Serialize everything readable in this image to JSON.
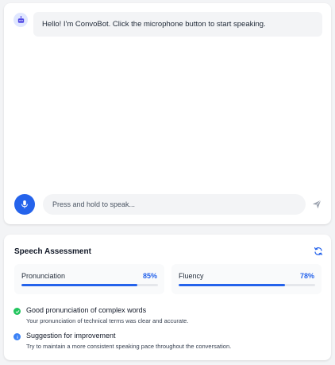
{
  "chat": {
    "bot_message": "Hello! I'm ConvoBot. Click the microphone button to start speaking.",
    "input_placeholder": "Press and hold to speak...",
    "bot_avatar_icon": "robot-icon",
    "mic_icon": "microphone-icon",
    "send_icon": "send-icon"
  },
  "assessment": {
    "title": "Speech Assessment",
    "refresh_icon": "refresh-icon",
    "metrics": [
      {
        "label": "Pronunciation",
        "value_text": "85%",
        "value": 85
      },
      {
        "label": "Fluency",
        "value_text": "78%",
        "value": 78
      }
    ],
    "feedback": [
      {
        "type": "success",
        "icon": "check-circle-icon",
        "title": "Good pronunciation of complex words",
        "description": "Your pronunciation of technical terms was clear and accurate."
      },
      {
        "type": "info",
        "icon": "info-circle-icon",
        "title": "Suggestion for improvement",
        "description": "Try to maintain a more consistent speaking pace throughout the conversation."
      }
    ]
  },
  "colors": {
    "accent": "#2563eb",
    "success": "#22c55e",
    "info": "#3b82f6",
    "background": "#f3f4f6"
  }
}
